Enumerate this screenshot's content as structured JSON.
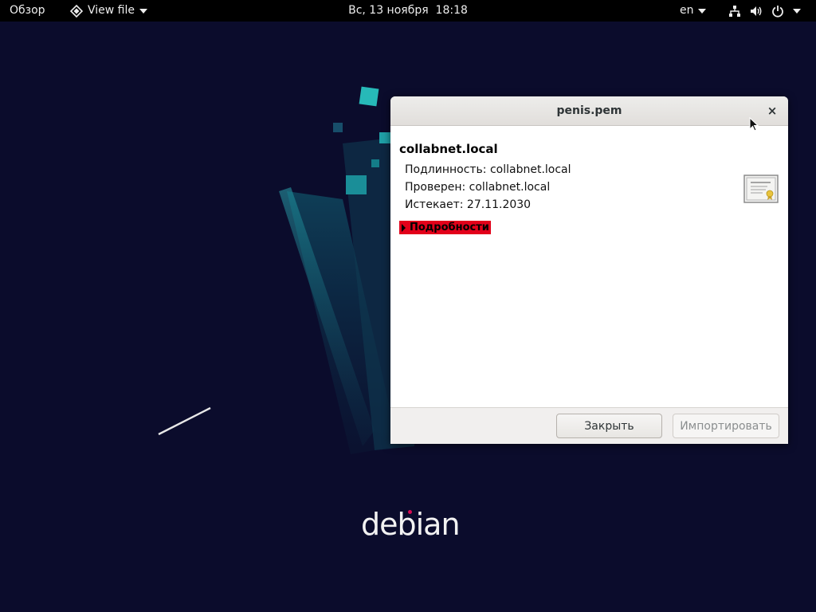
{
  "topbar": {
    "activities": "Обзор",
    "app_menu": "View file",
    "clock": "Вс, 13 ноября  18:18",
    "lang": "en",
    "icons": [
      "network-icon",
      "volume-icon",
      "power-icon"
    ]
  },
  "wallpaper": {
    "logo_text": "debian",
    "background_color": "#0b0c2c",
    "accent_color": "#1fa0a6"
  },
  "dialog": {
    "title": "penis.pem",
    "close_glyph": "×",
    "cert_name": "collabnet.local",
    "identity": "Подлинность: collabnet.local",
    "verified": "Проверен: collabnet.local",
    "expires": "Истекает: 27.11.2030",
    "details_label": "Подробности",
    "buttons": {
      "close": "Закрыть",
      "import": "Импортировать"
    },
    "highlight_color": "#e2001a"
  }
}
